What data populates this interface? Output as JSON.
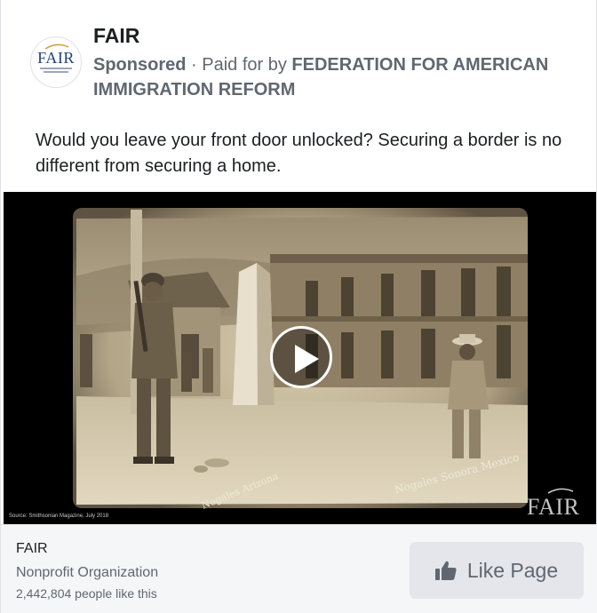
{
  "post": {
    "page_name": "FAIR",
    "sponsored_label": "Sponsored",
    "separator": " · ",
    "paid_for_prefix": "Paid for by ",
    "sponsor_name": "FEDERATION FOR AMERICAN IMMIGRATION REFORM",
    "avatar_text": "FAIR",
    "ad_text": "Would you leave your front door unlocked? Securing a border is no different from securing a home."
  },
  "media": {
    "type": "video",
    "play_icon": "play-icon",
    "source_caption": "Source: Smithsonian Magazine, July 2018",
    "watermark": "FAIR",
    "photo_inscription_left": "Nogales Arizona",
    "photo_inscription_right": "Nogales Sonora Mexico"
  },
  "footer": {
    "page_name": "FAIR",
    "category": "Nonprofit Organization",
    "likes": "2,442,804 people like this",
    "like_button_label": "Like Page",
    "like_icon": "thumbs-up-icon"
  },
  "colors": {
    "text_primary": "#1c1e21",
    "text_secondary": "#606770",
    "button_bg": "#e4e6eb",
    "footer_bg": "#f5f6f7",
    "brand_navy": "#21417a"
  }
}
